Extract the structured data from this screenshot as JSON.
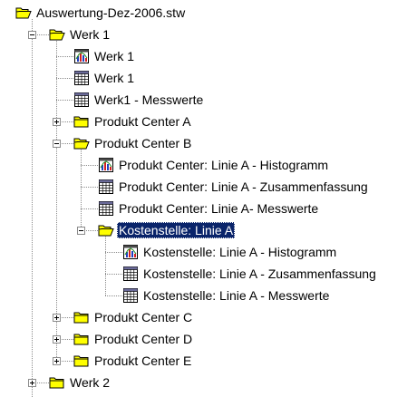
{
  "tree": {
    "nodes": [
      {
        "label": "Auswertung-Dez-2006.stw",
        "icon": "folder-open-icon",
        "depth": 0,
        "toggle": "none",
        "selected": false
      },
      {
        "label": "Werk 1",
        "icon": "folder-open-icon",
        "depth": 1,
        "toggle": "expanded",
        "selected": false
      },
      {
        "label": "Werk 1",
        "icon": "histogram-chart-icon",
        "depth": 2,
        "toggle": "none",
        "selected": false
      },
      {
        "label": "Werk 1",
        "icon": "data-table-icon",
        "depth": 2,
        "toggle": "none",
        "selected": false
      },
      {
        "label": "Werk1 - Messwerte",
        "icon": "data-table-icon",
        "depth": 2,
        "toggle": "none",
        "selected": false
      },
      {
        "label": "Produkt Center A",
        "icon": "folder-closed-icon",
        "depth": 2,
        "toggle": "collapsed",
        "selected": false
      },
      {
        "label": "Produkt Center B",
        "icon": "folder-open-icon",
        "depth": 2,
        "toggle": "expanded",
        "selected": false
      },
      {
        "label": "Produkt Center: Linie A - Histogramm",
        "icon": "histogram-chart-icon",
        "depth": 3,
        "toggle": "none",
        "selected": false
      },
      {
        "label": "Produkt Center: Linie A - Zusammenfassung",
        "icon": "data-table-icon",
        "depth": 3,
        "toggle": "none",
        "selected": false
      },
      {
        "label": "Produkt Center: Linie A- Messwerte",
        "icon": "data-table-icon",
        "depth": 3,
        "toggle": "none",
        "selected": false
      },
      {
        "label": "Kostenstelle: Linie A",
        "icon": "folder-open-icon",
        "depth": 3,
        "toggle": "expanded",
        "selected": true
      },
      {
        "label": "Kostenstelle: Linie A - Histogramm",
        "icon": "histogram-chart-icon",
        "depth": 4,
        "toggle": "none",
        "selected": false
      },
      {
        "label": "Kostenstelle: Linie A - Zusammenfassung",
        "icon": "data-table-icon",
        "depth": 4,
        "toggle": "none",
        "selected": false
      },
      {
        "label": "Kostenstelle: Linie A - Messwerte",
        "icon": "data-table-icon",
        "depth": 4,
        "toggle": "none",
        "selected": false
      },
      {
        "label": "Produkt Center C",
        "icon": "folder-closed-icon",
        "depth": 2,
        "toggle": "collapsed",
        "selected": false
      },
      {
        "label": "Produkt Center D",
        "icon": "folder-closed-icon",
        "depth": 2,
        "toggle": "collapsed",
        "selected": false
      },
      {
        "label": "Produkt Center E",
        "icon": "folder-closed-icon",
        "depth": 2,
        "toggle": "collapsed",
        "selected": false
      },
      {
        "label": "Werk 2",
        "icon": "folder-closed-icon",
        "depth": 1,
        "toggle": "collapsed",
        "selected": false
      }
    ]
  },
  "colors": {
    "folder": "#ffff00",
    "folder_stroke": "#000000",
    "selection": "#0a246a",
    "tree_lines": "#8c8c8c"
  }
}
